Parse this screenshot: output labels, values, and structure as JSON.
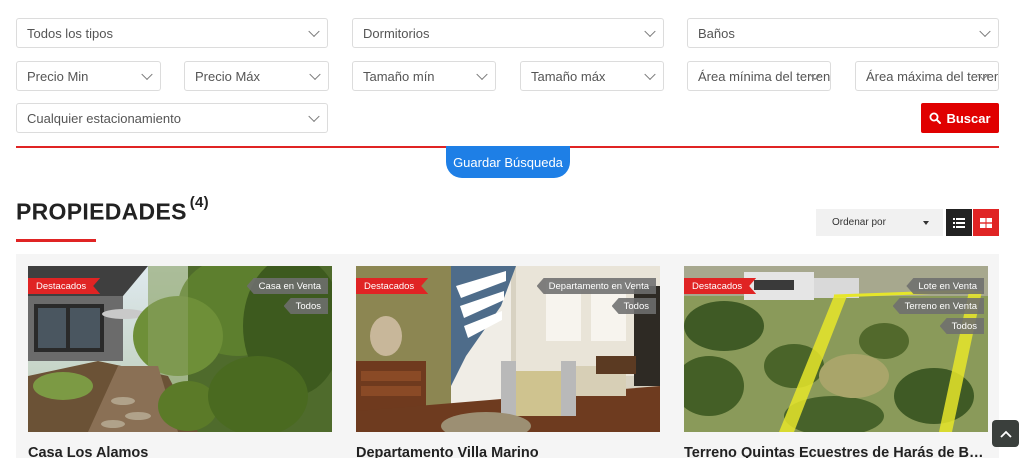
{
  "search": {
    "fields": [
      {
        "id": "type",
        "label": "Todos los tipos"
      },
      {
        "id": "bedrooms",
        "label": "Dormitorios"
      },
      {
        "id": "bathrooms",
        "label": "Baños"
      },
      {
        "id": "min_price",
        "label": "Precio Min"
      },
      {
        "id": "max_price",
        "label": "Precio Máx"
      },
      {
        "id": "min_size",
        "label": "Tamaño mín"
      },
      {
        "id": "max_size",
        "label": "Tamaño máx"
      },
      {
        "id": "min_land",
        "label": "Área mínima del terreno"
      },
      {
        "id": "max_land",
        "label": "Área máxima del terreno"
      },
      {
        "id": "parking",
        "label": "Cualquier estacionamiento"
      }
    ],
    "search_button": "Buscar",
    "save_search": "Guardar Búsqueda"
  },
  "listing": {
    "title": "PROPIEDADES",
    "count": "(4)",
    "sort_label": "Ordenar por"
  },
  "cards": [
    {
      "featured": "Destacados",
      "tags": [
        "Casa en Venta",
        "Todos"
      ],
      "title": "Casa Los Alamos"
    },
    {
      "featured": "Destacados",
      "tags": [
        "Departamento en Venta",
        "Todos"
      ],
      "title": "Departamento Villa Marino"
    },
    {
      "featured": "Destacados",
      "tags": [
        "Lote en Venta",
        "Terreno en Venta",
        "Todos"
      ],
      "title": "Terreno Quintas Ecuestres de Harás de Bella Vista"
    }
  ],
  "colors": {
    "accent_red": "#e02424",
    "button_red": "#e00000",
    "save_blue": "#1e7fe6",
    "dark": "#222222"
  },
  "icons": {
    "search": "magnifier-icon",
    "list_view": "list-icon",
    "grid_view": "grid-icon",
    "back_to_top": "chevron-up-icon"
  }
}
